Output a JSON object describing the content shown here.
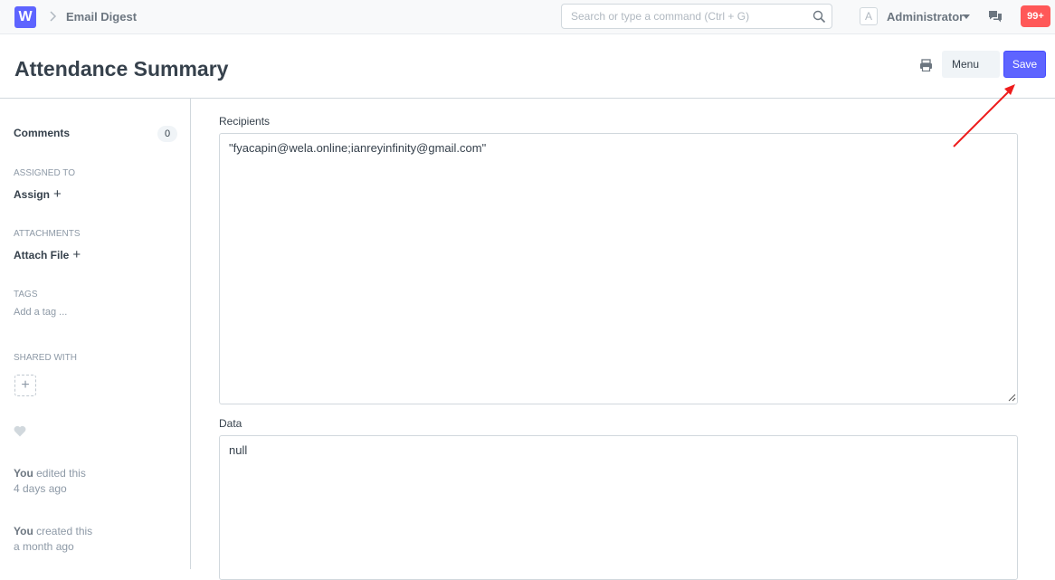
{
  "navbar": {
    "logo_letter": "W",
    "breadcrumb": "Email Digest",
    "search_placeholder": "Search or type a command (Ctrl + G)",
    "avatar_letter": "A",
    "user": "Administrator",
    "notifications": "99+"
  },
  "page": {
    "title": "Attendance Summary",
    "menu_label": "Menu",
    "save_label": "Save"
  },
  "sidebar": {
    "comments_label": "Comments",
    "comments_count": "0",
    "assigned_label": "ASSIGNED TO",
    "assign_label": "Assign",
    "attachments_label": "ATTACHMENTS",
    "attach_label": "Attach File",
    "tags_label": "TAGS",
    "add_tag_label": "Add a tag ...",
    "shared_label": "SHARED WITH",
    "activity": [
      {
        "who": "You",
        "action": "edited this",
        "when": "4 days ago"
      },
      {
        "who": "You",
        "action": "created this",
        "when": "a month ago"
      }
    ]
  },
  "form": {
    "recipients_label": "Recipients",
    "recipients_value": "\"fyacapin@wela.online;ianreyinfinity@gmail.com\"",
    "data_label": "Data",
    "data_value": "null"
  },
  "colors": {
    "primary": "#5e64ff",
    "notification": "#ff5858",
    "annotation_arrow": "#ee1c1c"
  }
}
